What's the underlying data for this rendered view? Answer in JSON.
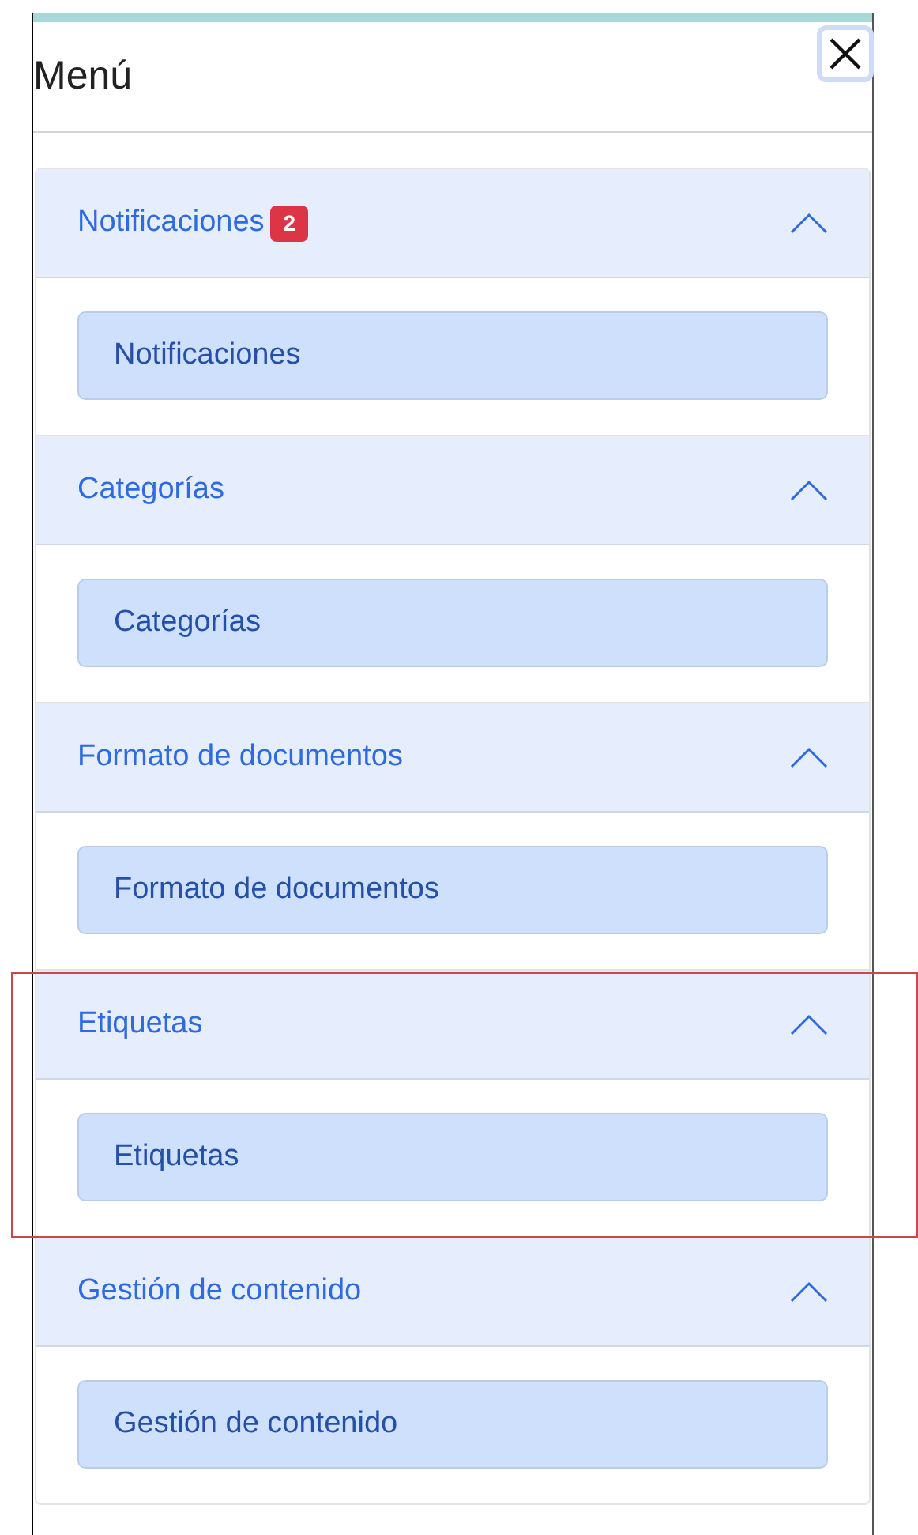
{
  "title": "Menú",
  "sections": [
    {
      "title": "Notificaciones",
      "badge": "2",
      "expanded": true,
      "highlighted": false,
      "items": [
        "Notificaciones"
      ]
    },
    {
      "title": "Categorías",
      "expanded": true,
      "highlighted": false,
      "items": [
        "Categorías"
      ]
    },
    {
      "title": "Formato de documentos",
      "expanded": true,
      "highlighted": false,
      "items": [
        "Formato de documentos"
      ]
    },
    {
      "title": "Etiquetas",
      "expanded": true,
      "highlighted": true,
      "items": [
        "Etiquetas"
      ]
    },
    {
      "title": "Gestión de contenido",
      "expanded": true,
      "highlighted": false,
      "items": [
        "Gestión de contenido"
      ]
    }
  ]
}
